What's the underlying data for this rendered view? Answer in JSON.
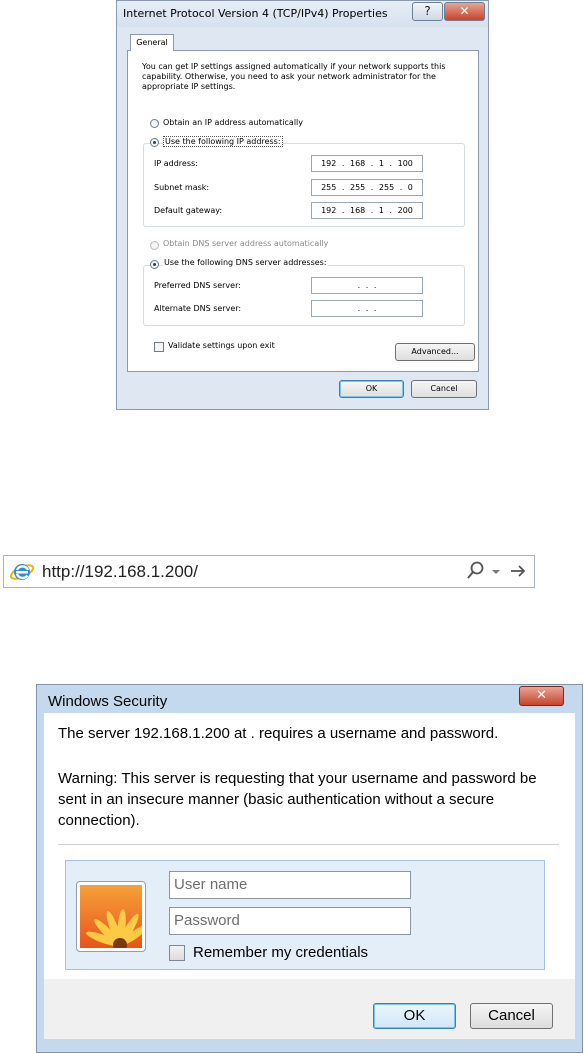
{
  "ipv4_dialog": {
    "title": "Internet Protocol Version 4 (TCP/IPv4) Properties",
    "help_button": "?",
    "close_button": "✕",
    "tab_general": "General",
    "intro": "You can get IP settings assigned automatically if your network supports this capability. Otherwise, you need to ask your network administrator for the appropriate IP settings.",
    "radio_auto_ip": "Obtain an IP address automatically",
    "radio_manual_ip": "Use the following IP address:",
    "ip_label": "IP address:",
    "ip_value": "192 . 168 . 1 . 100",
    "subnet_label": "Subnet mask:",
    "subnet_value": "255 . 255 . 255 . 0",
    "gateway_label": "Default gateway:",
    "gateway_value": "192 . 168 . 1 . 200",
    "radio_auto_dns": "Obtain DNS server address automatically",
    "radio_manual_dns": "Use the following DNS server addresses:",
    "preferred_dns_label": "Preferred DNS server:",
    "preferred_dns_value": ". . .",
    "alternate_dns_label": "Alternate DNS server:",
    "alternate_dns_value": ". . .",
    "validate_label": "Validate settings upon exit",
    "advanced_button": "Advanced...",
    "ok_button": "OK",
    "cancel_button": "Cancel"
  },
  "address_bar": {
    "url": "http://192.168.1.200/",
    "icons": [
      "ie-logo-icon",
      "search-icon",
      "dropdown-icon",
      "go-arrow-icon"
    ]
  },
  "security_dialog": {
    "title": "Windows Security",
    "close_button": "✕",
    "message": "The server 192.168.1.200 at . requires a username and password.",
    "warning": "Warning: This server is requesting that your username and password be sent in an insecure manner (basic authentication without a secure connection).",
    "username_placeholder": "User name",
    "password_placeholder": "Password",
    "remember_label": "Remember my credentials",
    "ok_button": "OK",
    "cancel_button": "Cancel"
  }
}
